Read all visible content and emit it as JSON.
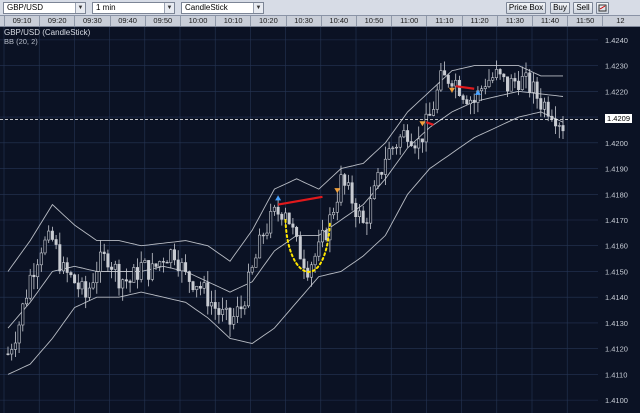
{
  "toolbar": {
    "symbol_select": "GBP/USD",
    "interval_select": "1 min",
    "chart_type_select": "CandleStick",
    "price_box_label": "Price Box",
    "buy_label": "Buy",
    "sell_label": "Sell",
    "settings_icon": "chart-settings-icon"
  },
  "time_axis": [
    "09:10",
    "09:20",
    "09:30",
    "09:40",
    "09:50",
    "10:00",
    "10:10",
    "10:20",
    "10:30",
    "10:40",
    "10:50",
    "11:00",
    "11:10",
    "11:20",
    "11:30",
    "11:40",
    "11:50",
    "12"
  ],
  "chart_header": {
    "title": "GBP/USD (CandleStick)",
    "indicator": "BB (20, 2)"
  },
  "price_axis": [
    "1.4240",
    "1.4230",
    "1.4220",
    "1.4210",
    "1.4200",
    "1.4190",
    "1.4180",
    "1.4170",
    "1.4160",
    "1.4150",
    "1.4140",
    "1.4130",
    "1.4120",
    "1.4110",
    "1.4100"
  ],
  "last_price": "1.4209",
  "colors": {
    "background": "#0b1224",
    "grid": "#263554",
    "candle": "#c9ccd3",
    "bands": "#b8bcc4",
    "annotation_red": "#e0191c",
    "annotation_yellow": "#ffe600",
    "marker_blue": "#4aa3ff",
    "marker_orange": "#f2a03a"
  },
  "chart_data": {
    "type": "candlestick",
    "title": "GBP/USD (CandleStick)",
    "indicator": "BB (20, 2)",
    "interval": "1 min",
    "xlabel": "",
    "ylabel": "",
    "ylim": [
      1.4095,
      1.4245
    ],
    "x_ticks": [
      "09:10",
      "09:20",
      "09:30",
      "09:40",
      "09:50",
      "10:00",
      "10:10",
      "10:20",
      "10:30",
      "10:40",
      "10:50",
      "11:00",
      "11:10",
      "11:20",
      "11:30",
      "11:40",
      "11:50"
    ],
    "grid": true,
    "last_price": 1.4209,
    "close_path": [
      [
        0,
        1.4118
      ],
      [
        3,
        1.413
      ],
      [
        6,
        1.4148
      ],
      [
        9,
        1.416
      ],
      [
        12,
        1.4162
      ],
      [
        15,
        1.415
      ],
      [
        18,
        1.4146
      ],
      [
        21,
        1.414
      ],
      [
        24,
        1.4152
      ],
      [
        27,
        1.4156
      ],
      [
        30,
        1.4148
      ],
      [
        33,
        1.4146
      ],
      [
        36,
        1.4152
      ],
      [
        39,
        1.415
      ],
      [
        42,
        1.4156
      ],
      [
        45,
        1.4158
      ],
      [
        48,
        1.4148
      ],
      [
        51,
        1.4146
      ],
      [
        54,
        1.414
      ],
      [
        57,
        1.4134
      ],
      [
        60,
        1.413
      ],
      [
        63,
        1.4136
      ],
      [
        66,
        1.415
      ],
      [
        69,
        1.4165
      ],
      [
        72,
        1.4172
      ],
      [
        75,
        1.4175
      ],
      [
        78,
        1.416
      ],
      [
        81,
        1.4152
      ],
      [
        84,
        1.4158
      ],
      [
        87,
        1.417
      ],
      [
        90,
        1.4185
      ],
      [
        93,
        1.4178
      ],
      [
        96,
        1.4168
      ],
      [
        99,
        1.418
      ],
      [
        102,
        1.4195
      ],
      [
        105,
        1.42
      ],
      [
        108,
        1.4205
      ],
      [
        111,
        1.42
      ],
      [
        114,
        1.421
      ],
      [
        117,
        1.4224
      ],
      [
        120,
        1.4226
      ],
      [
        123,
        1.422
      ],
      [
        126,
        1.4216
      ],
      [
        129,
        1.4224
      ],
      [
        132,
        1.4226
      ],
      [
        135,
        1.4222
      ],
      [
        138,
        1.4225
      ],
      [
        141,
        1.4222
      ],
      [
        144,
        1.4216
      ],
      [
        147,
        1.4213
      ],
      [
        150,
        1.4207
      ]
    ],
    "bollinger_upper": [
      [
        0,
        1.415
      ],
      [
        6,
        1.4162
      ],
      [
        12,
        1.4176
      ],
      [
        18,
        1.4168
      ],
      [
        24,
        1.4162
      ],
      [
        30,
        1.4162
      ],
      [
        36,
        1.416
      ],
      [
        42,
        1.4161
      ],
      [
        48,
        1.4162
      ],
      [
        54,
        1.416
      ],
      [
        60,
        1.4154
      ],
      [
        66,
        1.4166
      ],
      [
        72,
        1.4182
      ],
      [
        78,
        1.4186
      ],
      [
        84,
        1.4182
      ],
      [
        90,
        1.419
      ],
      [
        96,
        1.4192
      ],
      [
        102,
        1.42
      ],
      [
        108,
        1.4212
      ],
      [
        114,
        1.422
      ],
      [
        120,
        1.4228
      ],
      [
        126,
        1.423
      ],
      [
        132,
        1.423
      ],
      [
        138,
        1.423
      ],
      [
        144,
        1.4226
      ],
      [
        150,
        1.4226
      ]
    ],
    "bollinger_middle": [
      [
        0,
        1.4128
      ],
      [
        6,
        1.4138
      ],
      [
        12,
        1.415
      ],
      [
        18,
        1.4152
      ],
      [
        24,
        1.415
      ],
      [
        30,
        1.415
      ],
      [
        36,
        1.415
      ],
      [
        42,
        1.4152
      ],
      [
        48,
        1.415
      ],
      [
        54,
        1.4146
      ],
      [
        60,
        1.4142
      ],
      [
        66,
        1.4146
      ],
      [
        72,
        1.4158
      ],
      [
        78,
        1.4164
      ],
      [
        84,
        1.4164
      ],
      [
        90,
        1.417
      ],
      [
        96,
        1.4176
      ],
      [
        102,
        1.4186
      ],
      [
        108,
        1.4198
      ],
      [
        114,
        1.4206
      ],
      [
        120,
        1.4212
      ],
      [
        126,
        1.4216
      ],
      [
        132,
        1.4218
      ],
      [
        138,
        1.422
      ],
      [
        144,
        1.4219
      ],
      [
        150,
        1.4218
      ]
    ],
    "bollinger_lower": [
      [
        0,
        1.411
      ],
      [
        6,
        1.4114
      ],
      [
        12,
        1.4124
      ],
      [
        18,
        1.4136
      ],
      [
        24,
        1.414
      ],
      [
        30,
        1.414
      ],
      [
        36,
        1.4142
      ],
      [
        42,
        1.414
      ],
      [
        48,
        1.4138
      ],
      [
        54,
        1.4132
      ],
      [
        60,
        1.4124
      ],
      [
        66,
        1.4122
      ],
      [
        72,
        1.4128
      ],
      [
        78,
        1.4138
      ],
      [
        84,
        1.4148
      ],
      [
        90,
        1.415
      ],
      [
        96,
        1.4156
      ],
      [
        102,
        1.4164
      ],
      [
        108,
        1.418
      ],
      [
        114,
        1.419
      ],
      [
        120,
        1.4196
      ],
      [
        126,
        1.4202
      ],
      [
        132,
        1.4206
      ],
      [
        138,
        1.421
      ],
      [
        144,
        1.4212
      ],
      [
        150,
        1.4208
      ]
    ],
    "annotations": [
      {
        "type": "line",
        "color": "red",
        "from": [
          73,
          1.4176
        ],
        "to": [
          85,
          1.4179
        ]
      },
      {
        "type": "line",
        "color": "red",
        "from": [
          113,
          1.4208
        ],
        "to": [
          115,
          1.4207
        ]
      },
      {
        "type": "line",
        "color": "red",
        "from": [
          121,
          1.4222
        ],
        "to": [
          126,
          1.4221
        ]
      },
      {
        "type": "arc",
        "color": "yellow",
        "from": [
          75,
          1.417
        ],
        "to": [
          87,
          1.4165
        ]
      },
      {
        "type": "marker",
        "color": "blue",
        "shape": "up",
        "at": [
          73,
          1.4178
        ]
      },
      {
        "type": "marker",
        "color": "orange",
        "shape": "down",
        "at": [
          89,
          1.4182
        ]
      },
      {
        "type": "marker",
        "color": "orange",
        "shape": "down",
        "at": [
          112,
          1.4208
        ]
      },
      {
        "type": "marker",
        "color": "orange",
        "shape": "down",
        "at": [
          120,
          1.4221
        ]
      },
      {
        "type": "marker",
        "color": "blue",
        "shape": "up",
        "at": [
          127,
          1.4219
        ]
      }
    ]
  }
}
